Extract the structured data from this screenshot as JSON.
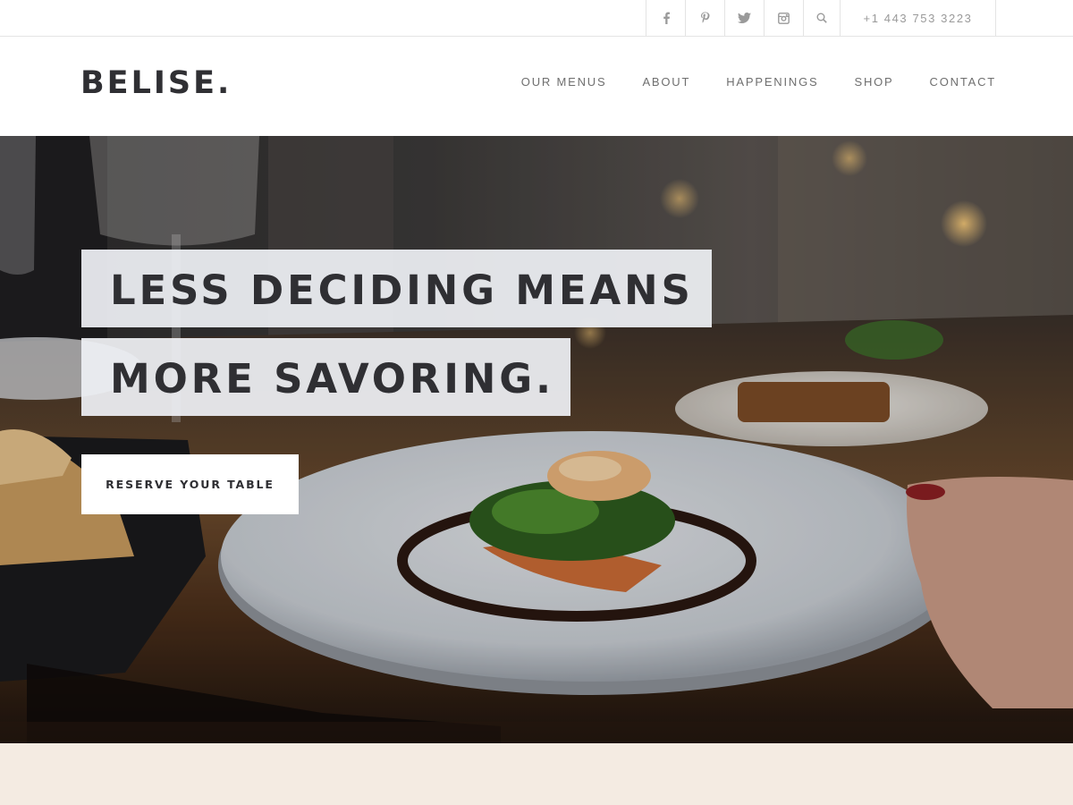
{
  "topbar": {
    "social": [
      {
        "name": "facebook-icon"
      },
      {
        "name": "pinterest-icon"
      },
      {
        "name": "twitter-icon"
      },
      {
        "name": "instagram-icon"
      },
      {
        "name": "search-icon"
      }
    ],
    "phone": "+1 443 753 3223"
  },
  "header": {
    "logo": "BELISE.",
    "nav": [
      "OUR MENUS",
      "ABOUT",
      "HAPPENINGS",
      "SHOP",
      "CONTACT"
    ]
  },
  "hero": {
    "headline_line1": "LESS DECIDING MEANS",
    "headline_line2": "MORE SAVORING.",
    "cta_label": "RESERVE YOUR TABLE"
  },
  "colors": {
    "text_dark": "#2f2f33",
    "nav_text": "#6f6f6f",
    "footer_strip": "#f4ebe2",
    "headline_box": "#eef0f4"
  }
}
